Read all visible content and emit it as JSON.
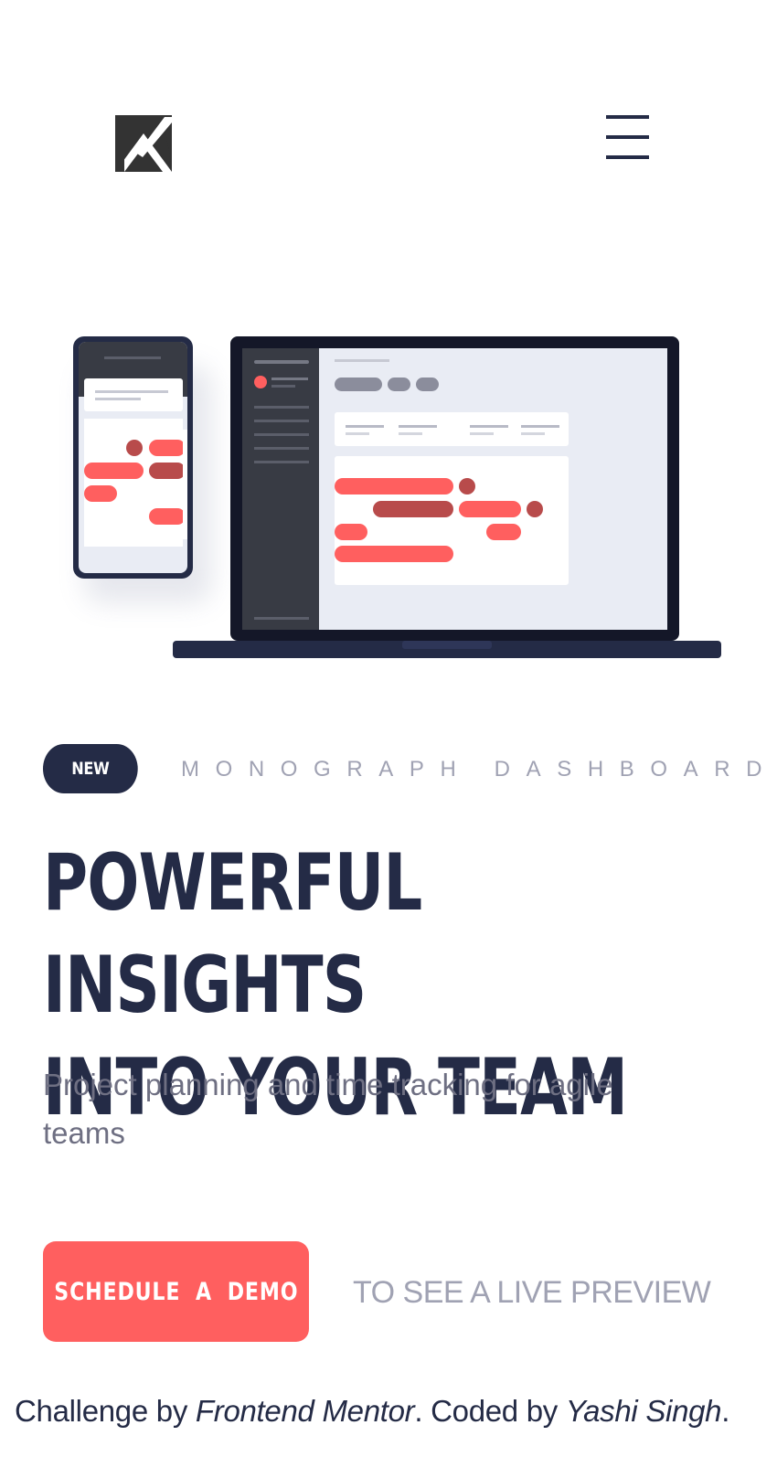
{
  "header": {
    "logo_icon": "k-logo-icon",
    "menu_icon": "hamburger-menu-icon"
  },
  "hero": {
    "illustration": "devices-dashboard-illustration"
  },
  "tagline": {
    "badge": "NEW",
    "text": "MONOGRAPH DASHBOARD"
  },
  "headline": {
    "line1": "POWERFUL INSIGHTS",
    "line2": "INTO YOUR TEAM"
  },
  "subtext": "Project planning and time tracking for agile teams",
  "cta": {
    "button_label": "SCHEDULE A DEMO",
    "preview_text": "TO SEE A LIVE PREVIEW"
  },
  "attribution": {
    "prefix": "Challenge by ",
    "challenge_link": "Frontend Mentor",
    "middle": ". Coded by ",
    "author_link": "Yashi Singh",
    "suffix": "."
  },
  "colors": {
    "dark": "#242b46",
    "accent": "#ff5f5f",
    "accent_dark": "#b84b4b",
    "gray": "#a0a2b3",
    "gray_text": "#6e6f82"
  }
}
